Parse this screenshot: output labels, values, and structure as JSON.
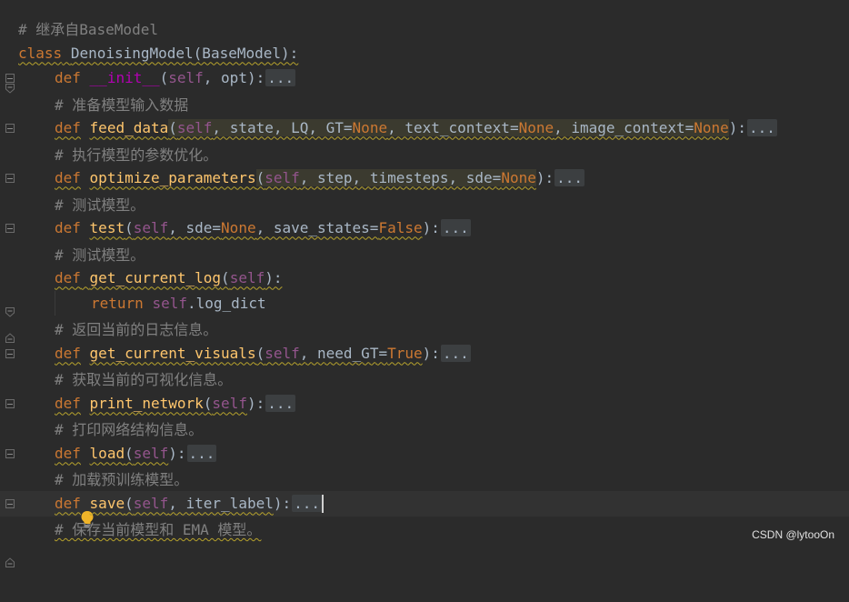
{
  "editor": {
    "lines": [
      {
        "comment": "# 继承自BaseModel"
      },
      {
        "kw": "class",
        "name": "DenoisingModel",
        "rest": "(BaseModel):"
      },
      {
        "kw": "def",
        "name": "__init__",
        "open": "(",
        "self": "self",
        "params": ", opt",
        "close": "):",
        "ellipsis": "..."
      },
      {
        "comment": "# 准备模型输入数据"
      },
      {
        "kw": "def",
        "name": "feed_data",
        "open": "(",
        "self": "self",
        "p1": ", state, LQ, GT=",
        "n1": "None",
        "p2": ", text_context=",
        "n2": "None",
        "p3": ", image_context=",
        "n3": "None",
        "close": "):",
        "ellipsis": "..."
      },
      {
        "comment": "# 执行模型的参数优化。"
      },
      {
        "kw": "def",
        "name": "optimize_parameters",
        "open": "(",
        "self": "self",
        "p1": ", step, timesteps, sde=",
        "n1": "None",
        "close": "):",
        "ellipsis": "..."
      },
      {
        "comment": "# 测试模型。"
      },
      {
        "kw": "def",
        "name": "test",
        "open": "(",
        "self": "self",
        "p1": ", sde=",
        "n1": "None",
        "p2": ", save_states=",
        "n2": "False",
        "close": "):",
        "ellipsis": "..."
      },
      {
        "comment": "# 测试模型。"
      },
      {
        "kw": "def",
        "name": "get_current_log",
        "open": "(",
        "self": "self",
        "close": "):"
      },
      {
        "kw": "return",
        "self": "self",
        "rest": ".log_dict"
      },
      {
        "comment": "# 返回当前的日志信息。"
      },
      {
        "kw": "def",
        "name": "get_current_visuals",
        "open": "(",
        "self": "self",
        "p1": ", need_GT=",
        "n1": "True",
        "close": "):",
        "ellipsis": "..."
      },
      {
        "comment": "# 获取当前的可视化信息。"
      },
      {
        "kw": "def",
        "name": "print_network",
        "open": "(",
        "self": "self",
        "close": "):",
        "ellipsis": "..."
      },
      {
        "comment": "# 打印网络结构信息。"
      },
      {
        "kw": "def",
        "name": "load",
        "open": "(",
        "self": "self",
        "close": "):",
        "ellipsis": "..."
      },
      {
        "comment": "# 加载预训练模型。"
      },
      {
        "kw": "def",
        "name": "save",
        "open": "(",
        "self": "self",
        "p1": ", iter_label",
        "close": "):",
        "ellipsis": "..."
      },
      {
        "comment": "# 保存当前模型和 EMA 模型。"
      }
    ]
  },
  "watermark": "CSDN @lytooOn",
  "colors": {
    "background": "#2b2b2b",
    "keyword": "#cc7832",
    "function": "#ffc66d",
    "self": "#94558d",
    "comment": "#808080",
    "text": "#a9b7c6"
  }
}
